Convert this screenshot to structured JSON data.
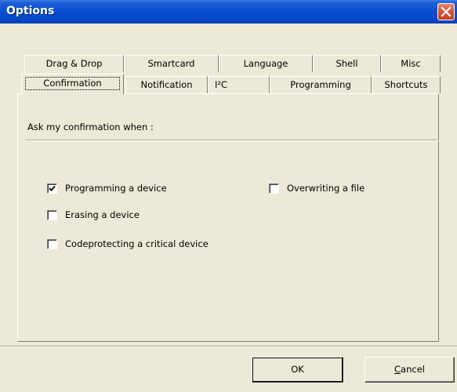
{
  "window": {
    "title": "Options",
    "close_icon": "close-icon"
  },
  "tabs": {
    "row1": [
      {
        "label": "Drag & Drop"
      },
      {
        "label": "Smartcard"
      },
      {
        "label": "Language"
      },
      {
        "label": "Shell"
      },
      {
        "label": "Misc"
      }
    ],
    "row2": [
      {
        "label": "Confirmation",
        "selected": true
      },
      {
        "label": "Notification"
      },
      {
        "label": "I²C"
      },
      {
        "label": "Programming"
      },
      {
        "label": "Shortcuts"
      }
    ]
  },
  "confirmation": {
    "heading": "Ask my confirmation when :",
    "options": [
      {
        "label": "Programming a device",
        "checked": true
      },
      {
        "label": "Erasing a device",
        "checked": false
      },
      {
        "label": "Codeprotecting a critical device",
        "checked": false
      },
      {
        "label": "Overwriting a file",
        "checked": false
      }
    ]
  },
  "buttons": {
    "ok_label": "OK",
    "cancel_first_letter": "C",
    "cancel_rest": "ancel"
  },
  "colors": {
    "titlebar": "#0548c9",
    "dialog_bg": "#ece9d8",
    "close_button": "#d9553a"
  }
}
